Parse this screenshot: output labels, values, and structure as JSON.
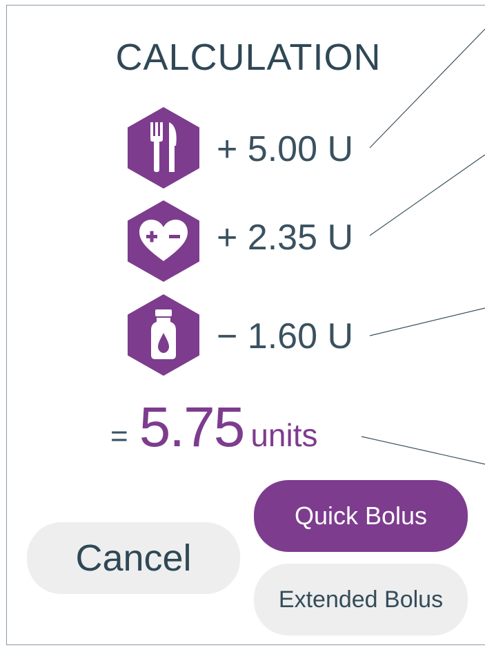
{
  "calculation": {
    "title": "CALCULATION",
    "rows": [
      {
        "icon": "fork-knife-icon",
        "amount": "+ 5.00 U"
      },
      {
        "icon": "heart-plus-minus-icon",
        "amount": "+ 2.35 U"
      },
      {
        "icon": "insulin-bottle-icon",
        "amount": "− 1.60 U"
      }
    ],
    "total": {
      "equals": "=",
      "value": "5.75",
      "unit": "units"
    }
  },
  "actions": {
    "quick_bolus": "Quick Bolus",
    "extended_bolus": "Extended Bolus",
    "cancel": "Cancel"
  },
  "colors": {
    "accent": "#7d3c8e",
    "text": "#2f4856",
    "button_gray": "#eeeeee"
  }
}
